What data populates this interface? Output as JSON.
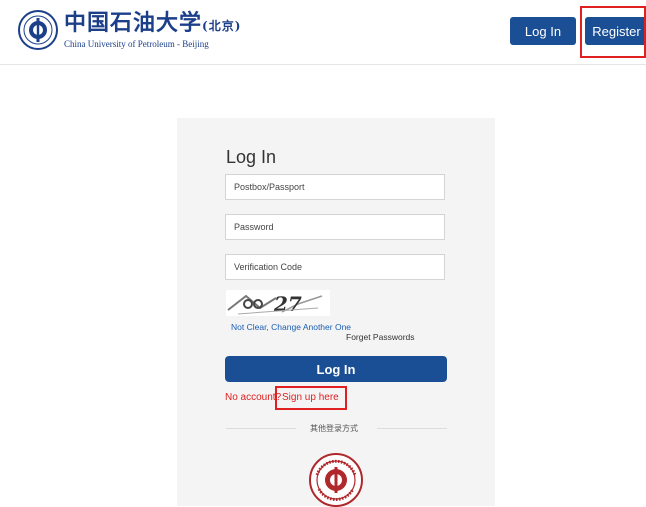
{
  "header": {
    "logo_cn": "中国石油大学",
    "logo_cn_small": "(北京)",
    "logo_en": "China University of Petroleum - Beijing",
    "login_label": "Log In",
    "register_label": "Register"
  },
  "form": {
    "title": "Log In",
    "postbox_placeholder": "Postbox/Passport",
    "password_placeholder": "Password",
    "verification_placeholder": "Verification Code",
    "captcha_text": "27",
    "change_link": "Not Clear, Change Another One",
    "forget_link": "Forget Passwords",
    "submit_label": "Log In",
    "no_account": "No account?",
    "signup_link": "Sign up here",
    "other_methods": "其他登录方式"
  },
  "colors": {
    "primary": "#1a4f95",
    "highlight": "#e02020"
  }
}
